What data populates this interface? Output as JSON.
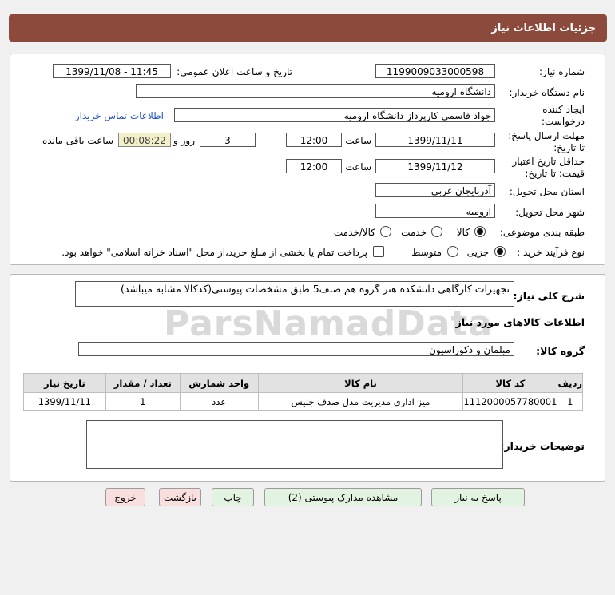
{
  "header": {
    "title": "جزئیات اطلاعات نیاز"
  },
  "fields": {
    "need_number_label": "شماره نیاز:",
    "need_number": "1199009033000598",
    "announce_label": "تاریخ و ساعت اعلان عمومی:",
    "announce_value": "1399/11/08 - 11:45",
    "buyer_org_label": "نام دستگاه خریدار:",
    "buyer_org": "دانشگاه ارومیه",
    "creator_label_1": "ایجاد کننده",
    "creator_label_2": "درخواست:",
    "creator": "جواد قاسمی کارپرداز دانشگاه ارومیه",
    "contact_link": "اطلاعات تماس خریدار",
    "reply_label_1": "مهلت ارسال پاسخ:",
    "reply_label_2": "تا تاریخ:",
    "reply_date": "1399/11/11",
    "time_label": "ساعت",
    "reply_time": "12:00",
    "days": "3",
    "days_label": "روز و",
    "remaining": "00:08:22",
    "remaining_label": "ساعت باقی مانده",
    "validity_label_1": "حداقل تاریخ اعتبار",
    "validity_label_2": "قیمت: تا تاریخ:",
    "validity_date": "1399/11/12",
    "validity_time_label": "ساعت",
    "validity_time": "12:00",
    "province_label": "استان محل تحویل:",
    "province": "آذربایجان غربی",
    "city_label": "شهر محل تحویل:",
    "city": "ارومیه",
    "category_label": "طبقه بندی موضوعی:",
    "category_options": [
      "کالا",
      "خدمت",
      "کالا/خدمت"
    ],
    "category_selected": "کالا",
    "process_label": "نوع فرآیند خرید :",
    "process_options": [
      "جزیی",
      "متوسط"
    ],
    "process_selected": "جزیی",
    "payment_note": "پرداخت تمام یا بخشی از مبلغ خرید،از محل \"اسناد خزانه اسلامی\" خواهد بود."
  },
  "description": {
    "label": "شرح کلی نیاز:",
    "text": "تجهیزات کارگاهی دانشکده هنر گروه هم صنف5 طبق مشخصات پیوستی(کدکالا مشابه میباشد)"
  },
  "goods": {
    "section_title": "اطلاعات کالاهای مورد نیاز",
    "group_label": "گروه کالا:",
    "group_value": "مبلمان و دکوراسیون",
    "columns": [
      "ردیف",
      "کد کالا",
      "نام کالا",
      "واحد شمارش",
      "تعداد / مقدار",
      "تاریخ نیاز"
    ],
    "rows": [
      [
        "1",
        "1112000057780001",
        "میز اداری مدیریت مدل صدف جلیس",
        "عدد",
        "1",
        "1399/11/11"
      ]
    ]
  },
  "notes": {
    "label": "توضیحات خریدار:",
    "text": ""
  },
  "buttons": {
    "reply": "پاسخ به نیاز",
    "docs": "مشاهده مدارک پیوستی (2)",
    "print": "چاپ",
    "back": "بازگشت",
    "exit": "خروج"
  },
  "colors": {
    "header_bg": "#8b4a3c",
    "remaining_bg": "#f3f0c8",
    "green_btn": "#e3f3e1",
    "pink_btn": "#f9dede",
    "link": "#2356c8"
  },
  "watermark": {
    "text": "ParsNamadData"
  }
}
